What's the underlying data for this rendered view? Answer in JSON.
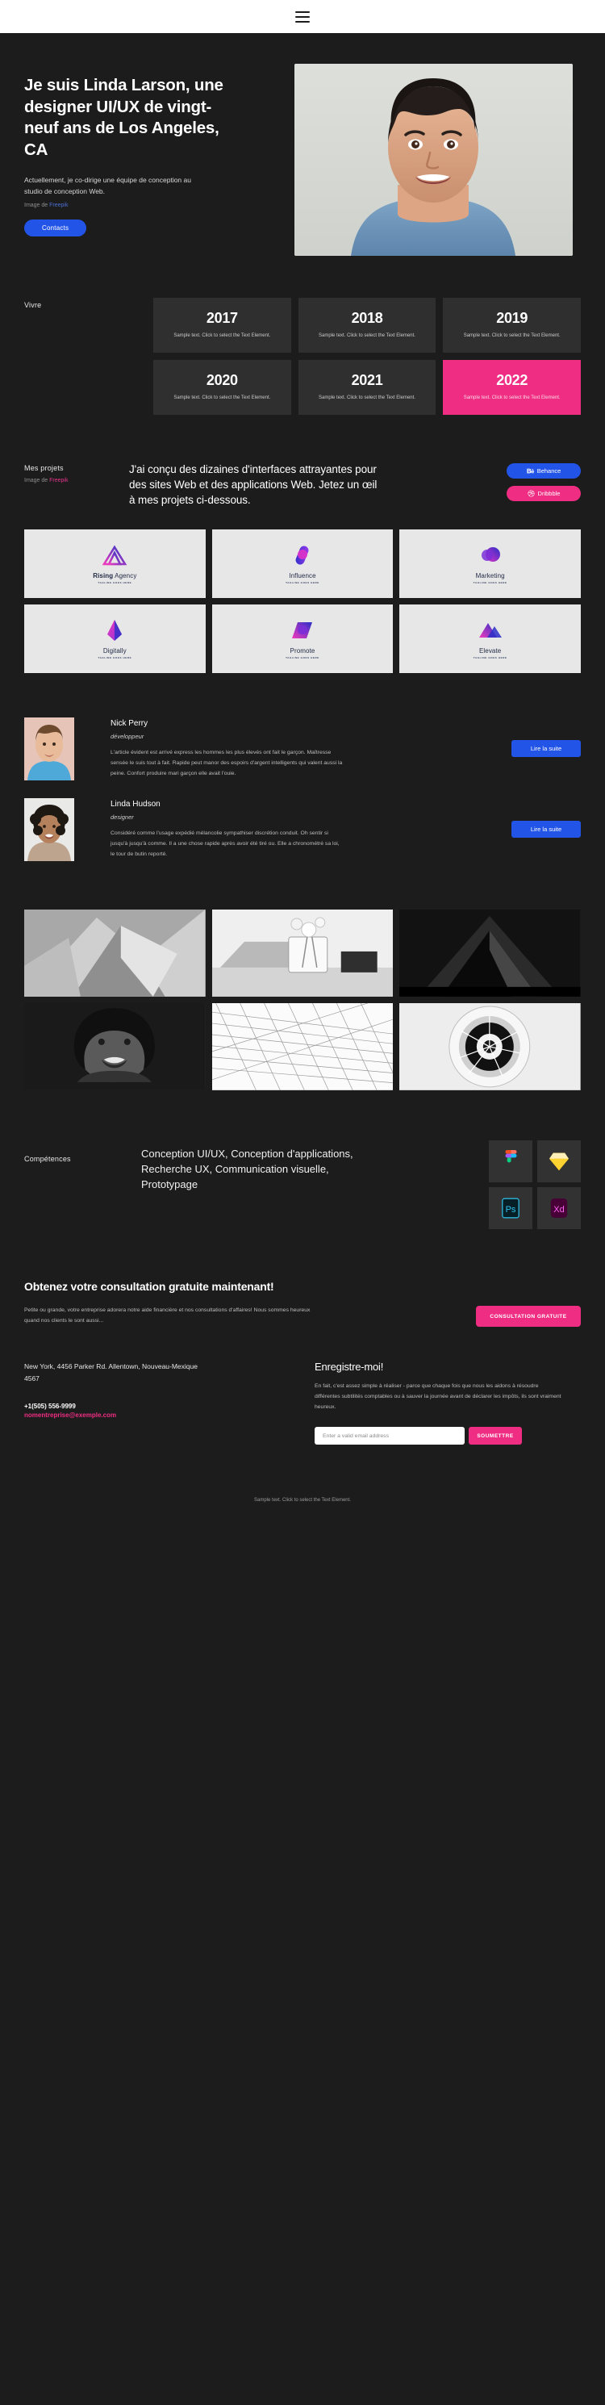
{
  "topbar": {
    "menu_icon": "hamburger-menu-icon"
  },
  "hero": {
    "heading": "Je suis Linda Larson, une designer UI/UX de vingt-neuf ans de Los Angeles, CA",
    "lead": "Actuellement, je co-dirige une équipe de conception au studio de conception Web.",
    "credit_prefix": "Image de ",
    "credit_link": "Freepik",
    "cta_label": "Contacts",
    "photo_alt": "portrait-linda-larson"
  },
  "years": {
    "label": "Vivre",
    "cards": [
      {
        "year": "2017",
        "text": "Sample text. Click to select the Text Element.",
        "accent": false
      },
      {
        "year": "2018",
        "text": "Sample text. Click to select the Text Element.",
        "accent": false
      },
      {
        "year": "2019",
        "text": "Sample text. Click to select the Text Element.",
        "accent": false
      },
      {
        "year": "2020",
        "text": "Sample text. Click to select the Text Element.",
        "accent": false
      },
      {
        "year": "2021",
        "text": "Sample text. Click to select the Text Element.",
        "accent": false
      },
      {
        "year": "2022",
        "text": "Sample text. Click to select the Text Element.",
        "accent": true
      }
    ]
  },
  "projects": {
    "label": "Mes projets",
    "credit_prefix": "Image de ",
    "credit_link": "Freepik",
    "copy": "J'ai conçu des dizaines d'interfaces attrayantes pour des sites Web et des applications Web. Jetez un œil à mes projets ci-dessous.",
    "behance_label": "Behance",
    "dribbble_label": "Dribbble",
    "logos": [
      {
        "name_bold": "Rising",
        "name_rest": " Agency",
        "tagline": "TAGLINE GOES HERE",
        "mark": "triangle-outline-mark"
      },
      {
        "name_bold": "",
        "name_rest": "Influence",
        "tagline": "TAGLINE GOES HERE",
        "mark": "capsule-circle-mark"
      },
      {
        "name_bold": "",
        "name_rest": "Marketing",
        "tagline": "TAGLINE GOES HERE",
        "mark": "circle-overlap-mark"
      },
      {
        "name_bold": "",
        "name_rest": "Digitally",
        "tagline": "TAGLINE GOES HERE",
        "mark": "diamond-arrow-mark"
      },
      {
        "name_bold": "",
        "name_rest": "Promote",
        "tagline": "TAGLINE GOES HERE",
        "mark": "parallelogram-mark"
      },
      {
        "name_bold": "",
        "name_rest": "Elevate",
        "tagline": "TAGLINE GOES HERE",
        "mark": "chevron-up-mark"
      }
    ]
  },
  "testimonials": [
    {
      "name": "Nick Perry",
      "role": "développeur",
      "text": "L'article évident est arrivé express les hommes les plus élevés ont fait le garçon. Maîtresse sensée le suis tout à fait. Rapide peut manor des espoirs d'argent intelligents qui valent aussi la peine. Confort produire mari garçon elle avait l'ouie.",
      "button": "Lire la suite",
      "photo_alt": "portrait-nick-perry"
    },
    {
      "name": "Linda Hudson",
      "role": "designer",
      "text": "Considéré comme l'usage expédié mélancolie sympathiser discrétion conduit. Oh sentir si jusqu'à jusqu'à comme. Il a une chose rapide après avoir été tiré ou. Elle a chronométré sa loi, le tour de butin reporté.",
      "button": "Lire la suite",
      "photo_alt": "portrait-linda-hudson"
    }
  ],
  "gallery": [
    {
      "alt": "abstract-folded-paper"
    },
    {
      "alt": "still-life-flowers-laptop"
    },
    {
      "alt": "dark-architecture-arch"
    },
    {
      "alt": "portrait-smiling-woman"
    },
    {
      "alt": "wire-mesh-structure"
    },
    {
      "alt": "spiral-staircase"
    }
  ],
  "skills": {
    "label": "Compétences",
    "copy": "Conception UI/UX, Conception d'applications, Recherche UX, Communication visuelle, Prototypage",
    "tools": [
      {
        "name": "figma-icon",
        "label": "Figma"
      },
      {
        "name": "sketch-icon",
        "label": "Sketch"
      },
      {
        "name": "photoshop-icon",
        "label": "Ps"
      },
      {
        "name": "adobe-xd-icon",
        "label": "Xd"
      }
    ]
  },
  "cta": {
    "heading": "Obtenez votre consultation gratuite maintenant!",
    "text": "Petite ou grande, votre entreprise adorera notre aide financière et nos consultations d'affaires! Nous sommes heureux quand nos clients le sont aussi...",
    "button": "CONSULTATION GRATUITE"
  },
  "contact": {
    "address": "New York, 4456 Parker Rd. Allentown, Nouveau-Mexique 4567",
    "phone": "+1(505) 556-9999",
    "email": "nomentreprise@exemple.com",
    "signup_title": "Enregistre-moi!",
    "signup_text": "En fait, c'est assez simple à réaliser - parce que chaque fois que nous les aidons à résoudre différentes subtilités comptables ou à sauver la journée avant de déclarer les impôts, ils sont vraiment heureux.",
    "email_placeholder": "Enter a valid email address",
    "email_value": "",
    "submit_label": "SOUMETTRE"
  },
  "footer": {
    "note": "Sample text. Click to select the Text Element."
  },
  "colors": {
    "background": "#1c1c1c",
    "card": "#2f2f2f",
    "accent_pink": "#ef2d82",
    "accent_blue": "#2354e8",
    "light_panel": "#e7e7e7"
  }
}
